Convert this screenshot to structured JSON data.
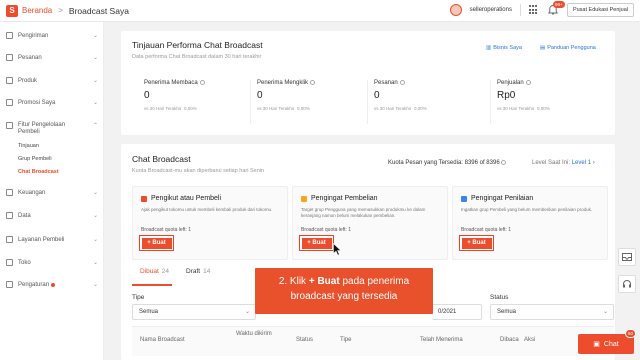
{
  "topbar": {
    "brand": "Beranda",
    "separator": ">",
    "breadcrumb_current": "Broadcast Saya",
    "username": "selleroperations",
    "notification_count": "99+",
    "edu_button": "Pusat Edukasi Penjual"
  },
  "sidebar": {
    "items": [
      {
        "label": "Pengiriman",
        "icon": "truck-icon"
      },
      {
        "label": "Pesanan",
        "icon": "order-icon"
      },
      {
        "label": "Produk",
        "icon": "box-icon"
      },
      {
        "label": "Promosi Saya",
        "icon": "promo-icon"
      },
      {
        "label": "Fitur Pengelolaan Pembeli",
        "icon": "people-icon"
      },
      {
        "label": "Keuangan",
        "icon": "wallet-icon"
      },
      {
        "label": "Data",
        "icon": "chart-icon"
      },
      {
        "label": "Layanan Pembeli",
        "icon": "support-icon"
      },
      {
        "label": "Toko",
        "icon": "shop-icon"
      },
      {
        "label": "Pengaturan",
        "icon": "settings-icon"
      }
    ],
    "subitems": [
      "Tinjauan",
      "Grup Pembeli",
      "Chat Broadcast"
    ]
  },
  "overview": {
    "title": "Tinjauan Performa Chat Broadcast",
    "subtitle": "Data performa Chat Broadcast dalam 30 hari terakhir",
    "link_bisnis": "Bisnis Saya",
    "link_panduan": "Panduan Pengguna",
    "stats": [
      {
        "label": "Penerima Membaca",
        "value": "0",
        "cmp_label": "vs 30 Hari Terakhir",
        "cmp_value": "0,00%"
      },
      {
        "label": "Penerima Mengklik",
        "value": "0",
        "cmp_label": "vs 30 Hari Terakhir",
        "cmp_value": "0,00%"
      },
      {
        "label": "Pesanan",
        "value": "0",
        "cmp_label": "vs 30 Hari Terakhir",
        "cmp_value": "0,00%"
      },
      {
        "label": "Penjualan",
        "value": "Rp0",
        "cmp_label": "vs 30 Hari Terakhir",
        "cmp_value": "0,00%"
      }
    ]
  },
  "broadcast": {
    "title": "Chat Broadcast",
    "subtitle": "Kuota Broadcast-mu akan diperbarui setiap hari Senin",
    "quota_label": "Kuota Pesan yang Tersedia:",
    "quota_value": "8396 of 8396",
    "level_label": "Level Saat Ini:",
    "level_value": "Level 1",
    "cards": [
      {
        "title": "Pengikut atau Pembeli",
        "desc": "Ajak pengikut tokomu untuk membeli kembali produk dari tokomu.",
        "quota": "Broadcast quota left: 1",
        "button": "+ Buat"
      },
      {
        "title": "Pengingat Pembelian",
        "desc": "Target grup Pengguna yang memasukkan produkmu ke dalam keranjang namun belum melakukan pembelian.",
        "quota": "Broadcast quota left: 1",
        "button": "+ Buat"
      },
      {
        "title": "Pengingat Penilaian",
        "desc": "Ingatkan grup Pembeli yang belum memberikan penilaian produk.",
        "quota": "Broadcast quota left: 1",
        "button": "+ Buat"
      }
    ],
    "tabs": [
      {
        "label": "Dibuat",
        "count": "24"
      },
      {
        "label": "Draft",
        "count": "14"
      }
    ],
    "filters": {
      "tipe_label": "Tipe",
      "tipe_value": "Semua",
      "status_label": "Status",
      "status_value": "Semua",
      "date_fragment": "0/2021"
    },
    "columns": [
      "Nama Broadcast",
      "Waktu dikirim",
      "Status",
      "Tipe",
      "Telah Menerima",
      "Dibaca",
      "Aksi"
    ]
  },
  "tooltip": {
    "prefix": "2. Klik ",
    "bold": "+ Buat",
    "suffix": " pada penerima",
    "line2": "broadcast yang tersedia"
  },
  "chat": {
    "label": "Chat",
    "badge": "60"
  },
  "colors": {
    "accent": "#ee4d2d",
    "link": "#2673dd"
  }
}
